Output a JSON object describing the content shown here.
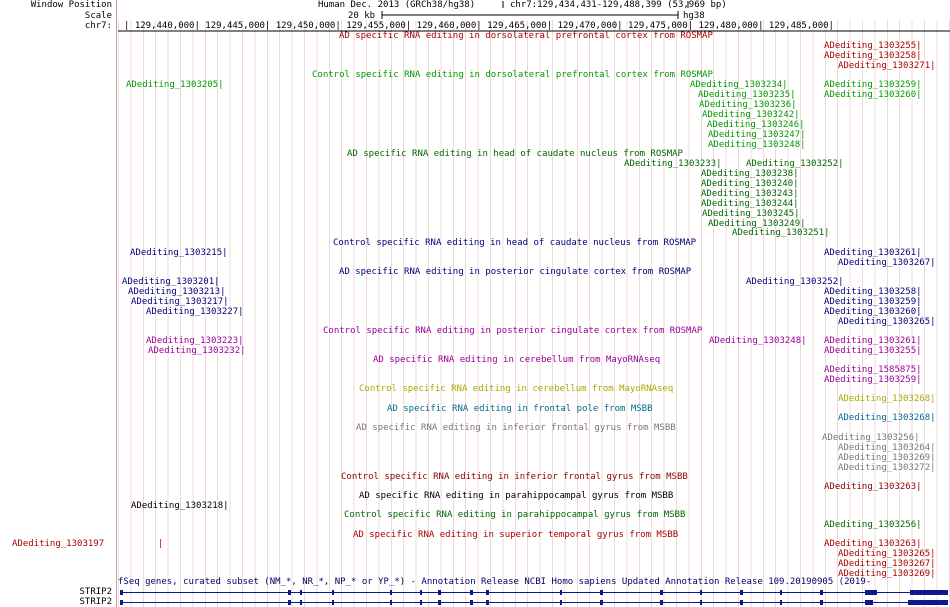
{
  "sidebar": {
    "window_position": "Window Position",
    "scale": "Scale",
    "chrom": "chr7:",
    "strip_label_1": "STRIP2",
    "strip_label_2": "STRIP2"
  },
  "ruler": {
    "assembly": "Human Dec. 2013 (GRCh38/hg38)",
    "position": "chr7:129,434,431-129,488,399 (53,969 bp)",
    "scale_value": "20 kb",
    "build": "hg38",
    "ticks": [
      "129,440,000",
      "129,445,000",
      "129,450,000",
      "129,455,000",
      "129,460,000",
      "129,465,000",
      "129,470,000",
      "129,475,000",
      "129,480,000",
      "129,485,000"
    ]
  },
  "colors": {
    "red": "#aa0000",
    "green": "#009900",
    "navy": "#000077",
    "purple": "#990099",
    "gold": "#aaaa00",
    "teal": "#006b8f",
    "gray": "#777777",
    "darkred": "#880000",
    "black": "#000000",
    "darkgreen": "#006600",
    "gene_blue": "#0a1a8a"
  },
  "tracks": [
    {
      "id": "t1",
      "title": "AD specific RNA editing in dorsolateral prefrontal cortex from ROSMAP",
      "color": "red"
    },
    {
      "id": "t2",
      "title": "Control specific RNA editing in dorsolateral prefrontal cortex from ROSMAP",
      "color": "green"
    },
    {
      "id": "t3",
      "title": "AD specific RNA editing in head of caudate nucleus from ROSMAP",
      "color": "darkgreen"
    },
    {
      "id": "t4",
      "title": "Control specific RNA editing in head of caudate nucleus from ROSMAP",
      "color": "navy"
    },
    {
      "id": "t5",
      "title": "AD specific RNA editing in posterior cingulate cortex from ROSMAP",
      "color": "navy"
    },
    {
      "id": "t6",
      "title": "Control specific RNA editing in posterior cingulate cortex from ROSMAP",
      "color": "purple"
    },
    {
      "id": "t7",
      "title": "AD specific RNA editing in cerebellum from MayoRNAseq",
      "color": "purple"
    },
    {
      "id": "t8",
      "title": "Control specific RNA editing in cerebellum from MayoRNAseq",
      "color": "gold"
    },
    {
      "id": "t9",
      "title": "AD specific RNA editing in frontal pole from MSBB",
      "color": "teal"
    },
    {
      "id": "t10",
      "title": "AD specific RNA editing in inferior frontal gyrus from MSBB",
      "color": "gray"
    },
    {
      "id": "t11",
      "title": "Control specific RNA editing in inferior frontal gyrus from MSBB",
      "color": "darkred"
    },
    {
      "id": "t12",
      "title": "AD specific RNA editing in parahippocampal gyrus from MSBB",
      "color": "black"
    },
    {
      "id": "t13",
      "title": "Control specific RNA editing in parahippocampal gyrus from MSBB",
      "color": "darkgreen"
    },
    {
      "id": "t14",
      "title": "AD specific RNA editing in superior temporal gyrus from MSBB",
      "color": "red"
    }
  ],
  "items": [
    {
      "label": "ADediting_1303255",
      "color": "red"
    },
    {
      "label": "ADediting_1303258",
      "color": "red"
    },
    {
      "label": "ADediting_1303271",
      "color": "red"
    },
    {
      "label": "ADediting_1303205",
      "color": "green"
    },
    {
      "label": "ADediting_1303234",
      "color": "green"
    },
    {
      "label": "ADediting_1303259",
      "color": "green"
    },
    {
      "label": "ADediting_1303235",
      "color": "green"
    },
    {
      "label": "ADediting_1303260",
      "color": "green"
    },
    {
      "label": "ADediting_1303236",
      "color": "green"
    },
    {
      "label": "ADediting_1303242",
      "color": "green"
    },
    {
      "label": "ADediting_1303246",
      "color": "green"
    },
    {
      "label": "ADediting_1303247",
      "color": "green"
    },
    {
      "label": "ADediting_1303248",
      "color": "green"
    },
    {
      "label": "ADediting_1303233",
      "color": "darkgreen"
    },
    {
      "label": "ADediting_1303252",
      "color": "darkgreen"
    },
    {
      "label": "ADediting_1303238",
      "color": "darkgreen"
    },
    {
      "label": "ADediting_1303240",
      "color": "darkgreen"
    },
    {
      "label": "ADediting_1303243",
      "color": "darkgreen"
    },
    {
      "label": "ADediting_1303244",
      "color": "darkgreen"
    },
    {
      "label": "ADediting_1303245",
      "color": "darkgreen"
    },
    {
      "label": "ADediting_1303249",
      "color": "darkgreen"
    },
    {
      "label": "ADediting_1303251",
      "color": "darkgreen"
    },
    {
      "label": "ADediting_1303215",
      "color": "navy"
    },
    {
      "label": "ADediting_1303261",
      "color": "navy"
    },
    {
      "label": "ADediting_1303267",
      "color": "navy"
    },
    {
      "label": "ADediting_1303201",
      "color": "navy"
    },
    {
      "label": "ADediting_1303252",
      "color": "navy"
    },
    {
      "label": "ADediting_1303213",
      "color": "navy"
    },
    {
      "label": "ADediting_1303258",
      "color": "navy"
    },
    {
      "label": "ADediting_1303217",
      "color": "navy"
    },
    {
      "label": "ADediting_1303259",
      "color": "navy"
    },
    {
      "label": "ADediting_1303227",
      "color": "navy"
    },
    {
      "label": "ADediting_1303260",
      "color": "navy"
    },
    {
      "label": "ADediting_1303265",
      "color": "navy"
    },
    {
      "label": "ADediting_1303223",
      "color": "purple"
    },
    {
      "label": "ADediting_1303248",
      "color": "purple"
    },
    {
      "label": "ADediting_1303261",
      "color": "purple"
    },
    {
      "label": "ADediting_1303232",
      "color": "purple"
    },
    {
      "label": "ADediting_1303255",
      "color": "purple"
    },
    {
      "label": "ADediting_1585875",
      "color": "purple"
    },
    {
      "label": "ADediting_1303259",
      "color": "purple"
    },
    {
      "label": "ADediting_1303268",
      "color": "gold"
    },
    {
      "label": "ADediting_1303268",
      "color": "teal"
    },
    {
      "label": "ADediting_1303256",
      "color": "gray"
    },
    {
      "label": "ADediting_1303264",
      "color": "gray"
    },
    {
      "label": "ADediting_1303269",
      "color": "gray"
    },
    {
      "label": "ADediting_1303272",
      "color": "gray"
    },
    {
      "label": "ADediting_1303263",
      "color": "darkred"
    },
    {
      "label": "ADediting_1303218",
      "color": "black"
    },
    {
      "label": "ADediting_1303256",
      "color": "darkgreen"
    },
    {
      "label": "ADediting_1303197",
      "color": "red"
    },
    {
      "label": "ADediting_1303263",
      "color": "red"
    },
    {
      "label": "ADediting_1303265",
      "color": "red"
    },
    {
      "label": "ADediting_1303267",
      "color": "red"
    },
    {
      "label": "ADediting_1303269",
      "color": "red"
    }
  ],
  "gene_track": {
    "title": "fSeq genes, curated subset (NM_*, NR_*, NP_* or YP_*) - Annotation Release NCBI Homo sapiens Updated Annotation Release 109.20190905 (2019-"
  }
}
